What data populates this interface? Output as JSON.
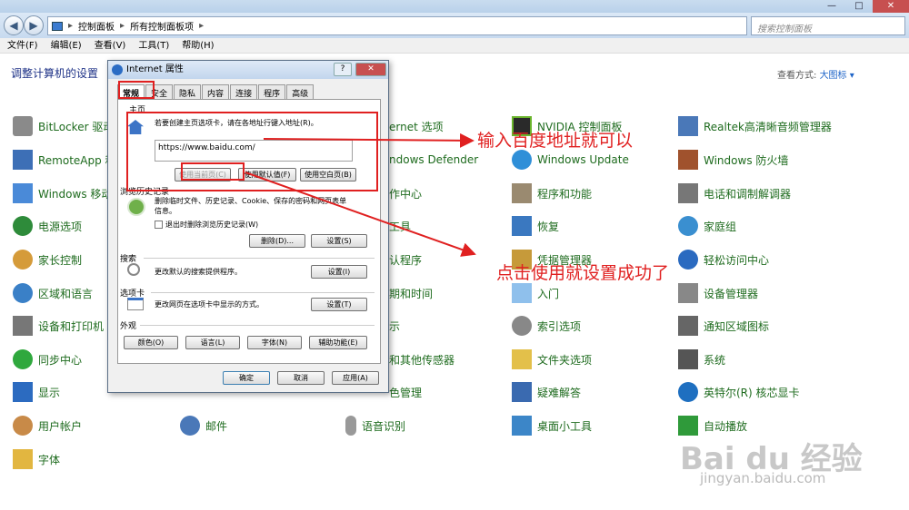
{
  "nav": {
    "back": "◀",
    "forward": "▶",
    "crumbs": [
      "控制面板",
      "所有控制面板项"
    ],
    "search_placeholder": "搜索控制面板"
  },
  "menu": [
    "文件(F)",
    "编辑(E)",
    "查看(V)",
    "工具(T)",
    "帮助(H)"
  ],
  "heading": "调整计算机的设置",
  "viewby": {
    "label": "查看方式:",
    "value": "大图标 ▾"
  },
  "col1": [
    "BitLocker 驱动",
    "RemoteApp 和",
    "Windows 移动",
    "电源选项",
    "家长控制",
    "区域和语言",
    "设备和打印机",
    "同步中心",
    "显示",
    "用户帐户",
    "字体"
  ],
  "col2": [
    "ernet 选项",
    "ndows Defender",
    "作中心",
    "工具",
    "认程序",
    "期和时间",
    "示",
    "和其他传感器",
    "色管理",
    "邮件"
  ],
  "col3": [
    "NVIDIA 控制面板",
    "Windows Update",
    "程序和功能",
    "恢复",
    "凭据管理器",
    "入门",
    "索引选项",
    "文件夹选项",
    "疑难解答",
    "桌面小工具",
    "语音识别"
  ],
  "col4": [
    "Realtek高清晰音频管理器",
    "Windows 防火墙",
    "电话和调制解调器",
    "家庭组",
    "轻松访问中心",
    "设备管理器",
    "通知区域图标",
    "系统",
    "英特尔(R) 核芯显卡",
    "自动播放"
  ],
  "dialog": {
    "title": "Internet 属性",
    "help": "?",
    "close": "✕",
    "tabs": [
      "常规",
      "安全",
      "隐私",
      "内容",
      "连接",
      "程序",
      "高级"
    ],
    "home": {
      "label": "主页",
      "desc": "若要创建主页选项卡，请在各地址行键入地址(R)。",
      "url": "https://www.baidu.com/",
      "btn_current": "使用当前页(C)",
      "btn_default": "使用默认值(F)",
      "btn_blank": "使用空白页(B)"
    },
    "history": {
      "label": "浏览历史记录",
      "desc": "删除临时文件、历史记录、Cookie、保存的密码和网页表单信息。",
      "checkbox": "退出时删除浏览历史记录(W)",
      "btn_delete": "删除(D)...",
      "btn_settings": "设置(S)"
    },
    "search": {
      "label": "搜索",
      "desc": "更改默认的搜索提供程序。",
      "btn": "设置(I)"
    },
    "tabsec": {
      "label": "选项卡",
      "desc": "更改网页在选项卡中显示的方式。",
      "btn": "设置(T)"
    },
    "appearance": {
      "label": "外观",
      "btn_colors": "颜色(O)",
      "btn_lang": "语言(L)",
      "btn_fonts": "字体(N)",
      "btn_access": "辅助功能(E)"
    },
    "ok": "确定",
    "cancel": "取消",
    "apply": "应用(A)"
  },
  "annotations": {
    "a1": "输入百度地址就可以",
    "a2": "点击使用就设置成功了"
  },
  "watermark": {
    "logo": "Bai du 经验",
    "url": "jingyan.baidu.com"
  }
}
